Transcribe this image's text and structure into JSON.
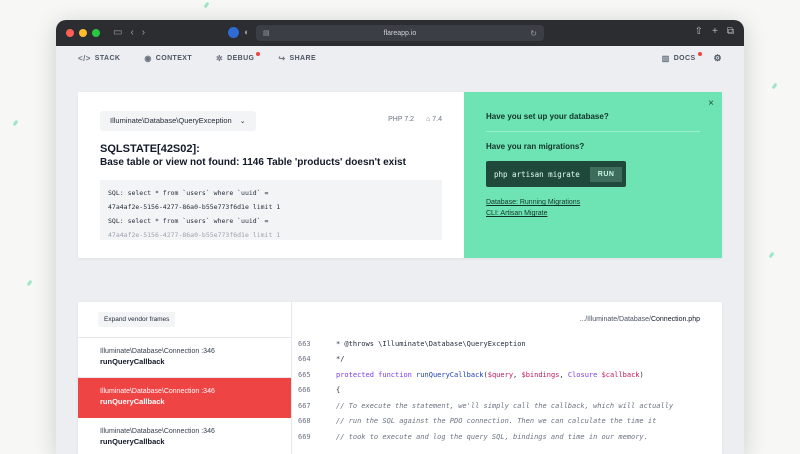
{
  "browser": {
    "url": "flareapp.io",
    "traffic_lights": [
      "#ff5f57",
      "#febc2e",
      "#28c840"
    ]
  },
  "nav": {
    "items": [
      {
        "label": "STACK",
        "icon": "code-icon"
      },
      {
        "label": "CONTEXT",
        "icon": "context-icon"
      },
      {
        "label": "DEBUG",
        "icon": "bug-icon"
      },
      {
        "label": "SHARE",
        "icon": "share-icon"
      }
    ],
    "docs": "DOCS"
  },
  "error": {
    "exception_class": "Illuminate\\Database\\QueryException",
    "php_version": "PHP 7.2",
    "laravel_version": "7.4",
    "code": "SQLSTATE[42S02]:",
    "message": "Base table or view not found: 1146 Table 'products' doesn't exist",
    "sql_lines": [
      "SQL: select * from `users` where `uuid` =",
      "47a4af2e-5156-4277-86a0-b55e773f6d1e limit 1",
      "SQL: select * from `users` where `uuid` =",
      "47a4af2e-5156-4277-86a0-b55e773f6d1e limit 1"
    ]
  },
  "solution": {
    "title": "Have you set up your database?",
    "subtitle": "Have you ran migrations?",
    "command": "php artisan migrate",
    "run_label": "RUN",
    "links": [
      "Database: Running Migrations",
      "CLI: Artisan Migrate"
    ],
    "accent": "#6ee3b3"
  },
  "stack": {
    "expand_label": "Expand vendor frames",
    "frames": [
      {
        "path": "Illuminate\\Database\\Connection",
        "line": ":346",
        "fn": "runQueryCallback",
        "active": false
      },
      {
        "path": "Illuminate\\Database\\Connection",
        "line": ":346",
        "fn": "runQueryCallback",
        "active": true
      },
      {
        "path": "Illuminate\\Database\\Connection",
        "line": ":346",
        "fn": "runQueryCallback",
        "active": false
      }
    ],
    "file_prefix": ".../Illuminate/Database/",
    "file_name": "Connection.php",
    "code": [
      {
        "num": "663",
        "text": "    * @throws \\Illuminate\\Database\\QueryException"
      },
      {
        "num": "664",
        "text": "    */"
      },
      {
        "num": "665",
        "text": "   protected function runQueryCallback($query, $bindings, Closure $callback)"
      },
      {
        "num": "666",
        "text": "   {"
      },
      {
        "num": "667",
        "text": "       // To execute the statement, we'll simply call the callback, which will actually"
      },
      {
        "num": "668",
        "text": "       // run the SQL against the PDO connection. Then we can calculate the time it"
      },
      {
        "num": "669",
        "text": "       // took to execute and log the query SQL, bindings and time in our memory."
      }
    ]
  }
}
